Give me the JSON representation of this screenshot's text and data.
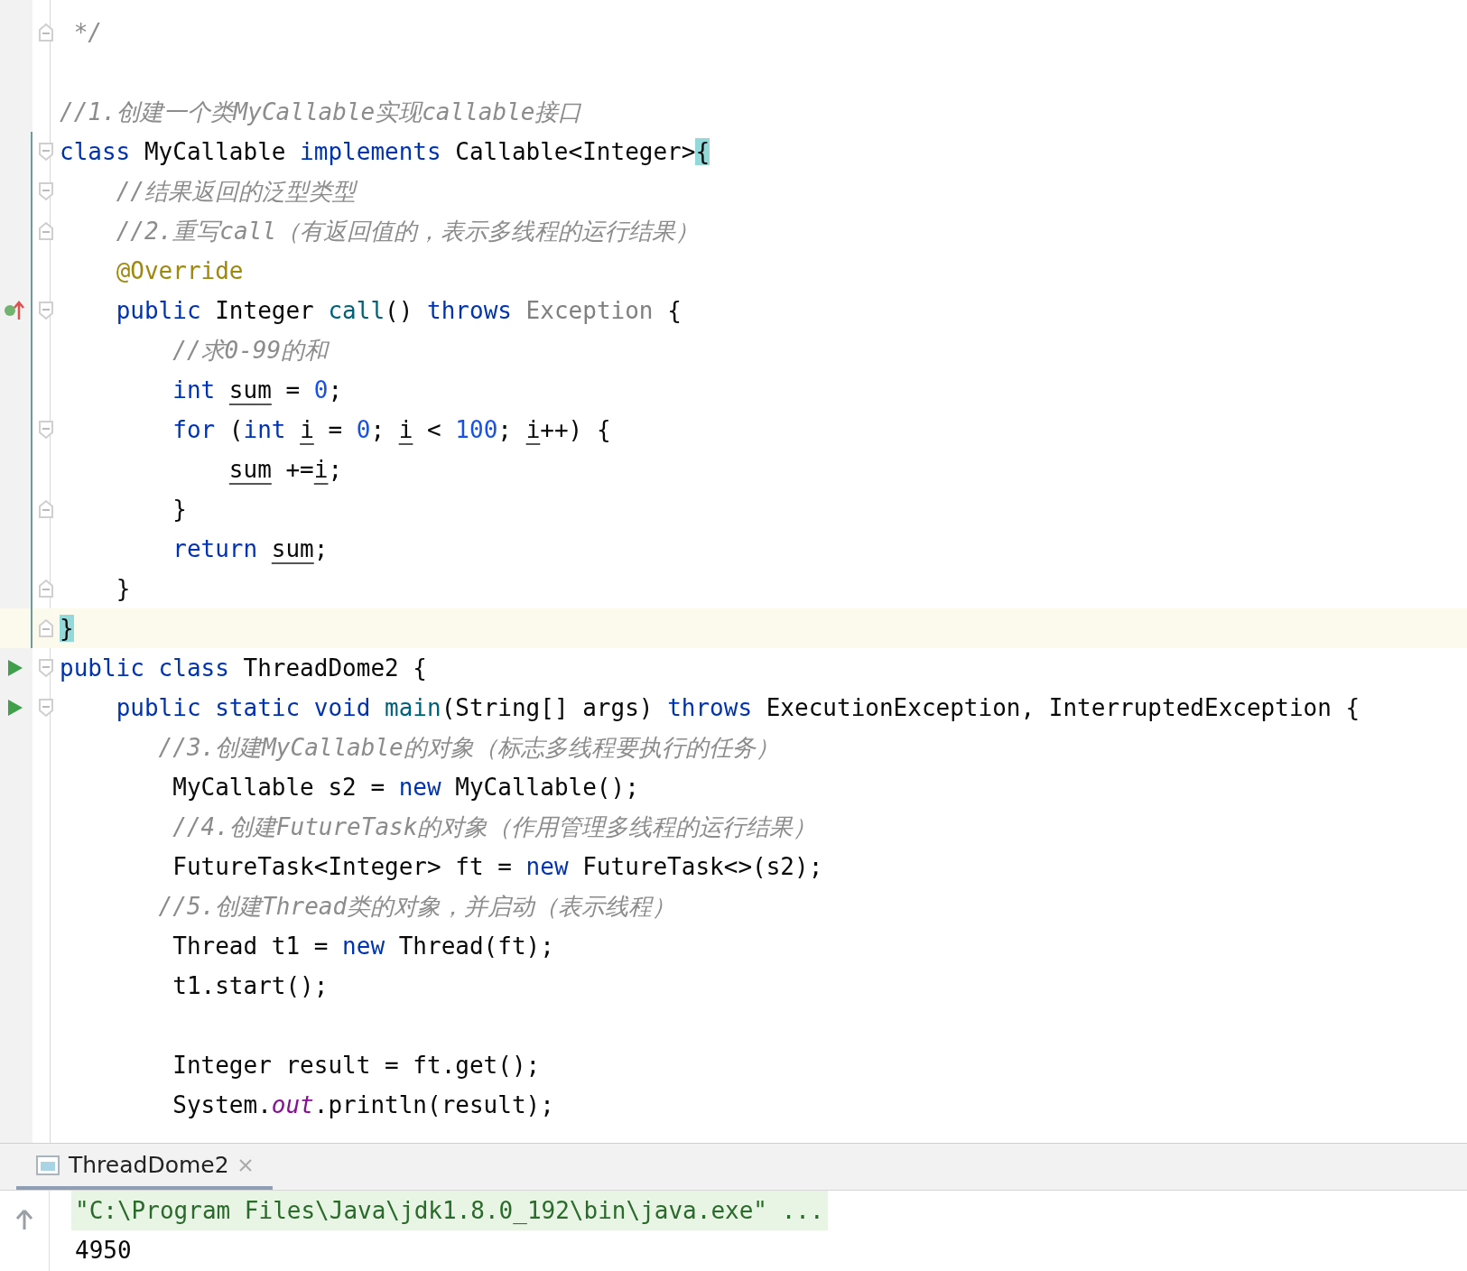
{
  "editor": {
    "lines": [
      {
        "fold_end": true,
        "tokens": [
          {
            "text": " */",
            "kind": "comment"
          }
        ]
      },
      {
        "kind": "blank"
      },
      {
        "tokens": [
          {
            "text": "//1.创建一个类MyCallable实现callable接口",
            "kind": "comment"
          }
        ]
      },
      {
        "changed": true,
        "fold_start": true,
        "tokens": [
          {
            "text": "class ",
            "kind": "keyword"
          },
          {
            "text": "MyCallable ",
            "kind": "plain"
          },
          {
            "text": "implements ",
            "kind": "keyword"
          },
          {
            "text": "Callable<Integer>",
            "kind": "plain"
          },
          {
            "text": "{",
            "kind": "matched"
          }
        ]
      },
      {
        "changed": true,
        "fold_start": true,
        "tokens": [
          {
            "text": "    //结果返回的泛型类型",
            "kind": "comment"
          }
        ]
      },
      {
        "changed": true,
        "fold_end": true,
        "tokens": [
          {
            "text": "    //2.重写call（有返回值的，表示多线程的运行结果）",
            "kind": "comment"
          }
        ]
      },
      {
        "changed": true,
        "tokens": [
          {
            "text": "    @Override",
            "kind": "annotation"
          }
        ]
      },
      {
        "changed": true,
        "fold_start": true,
        "override_marker": true,
        "tokens": [
          {
            "text": "    public ",
            "kind": "keyword"
          },
          {
            "text": "Integer ",
            "kind": "plain"
          },
          {
            "text": "call",
            "kind": "method"
          },
          {
            "text": "() ",
            "kind": "plain"
          },
          {
            "text": "throws ",
            "kind": "keyword"
          },
          {
            "text": "Exception ",
            "kind": "dim"
          },
          {
            "text": "{",
            "kind": "plain"
          }
        ]
      },
      {
        "changed": true,
        "tokens": [
          {
            "text": "        //求0-99的和",
            "kind": "comment"
          }
        ]
      },
      {
        "changed": true,
        "tokens": [
          {
            "text": "        int ",
            "kind": "keyword"
          },
          {
            "text": "sum",
            "kind": "variable"
          },
          {
            "text": " = ",
            "kind": "plain"
          },
          {
            "text": "0",
            "kind": "number"
          },
          {
            "text": ";",
            "kind": "plain"
          }
        ]
      },
      {
        "changed": true,
        "fold_start": true,
        "tokens": [
          {
            "text": "        for ",
            "kind": "keyword"
          },
          {
            "text": "(",
            "kind": "plain"
          },
          {
            "text": "int ",
            "kind": "keyword"
          },
          {
            "text": "i",
            "kind": "variable"
          },
          {
            "text": " = ",
            "kind": "plain"
          },
          {
            "text": "0",
            "kind": "number"
          },
          {
            "text": "; ",
            "kind": "plain"
          },
          {
            "text": "i",
            "kind": "variable"
          },
          {
            "text": " < ",
            "kind": "plain"
          },
          {
            "text": "100",
            "kind": "number"
          },
          {
            "text": "; ",
            "kind": "plain"
          },
          {
            "text": "i",
            "kind": "variable"
          },
          {
            "text": "++) {",
            "kind": "plain"
          }
        ]
      },
      {
        "changed": true,
        "tokens": [
          {
            "text": "            sum",
            "kind": "variable"
          },
          {
            "text": " +=",
            "kind": "plain"
          },
          {
            "text": "i",
            "kind": "variable"
          },
          {
            "text": ";",
            "kind": "plain"
          }
        ]
      },
      {
        "changed": true,
        "fold_end": true,
        "tokens": [
          {
            "text": "        }",
            "kind": "plain"
          }
        ]
      },
      {
        "changed": true,
        "tokens": [
          {
            "text": "        return ",
            "kind": "keyword"
          },
          {
            "text": "sum",
            "kind": "variable"
          },
          {
            "text": ";",
            "kind": "plain"
          }
        ]
      },
      {
        "changed": true,
        "fold_end": true,
        "tokens": [
          {
            "text": "    }",
            "kind": "plain"
          }
        ]
      },
      {
        "changed": true,
        "current": true,
        "fold_end": true,
        "tokens": [
          {
            "text": "}",
            "kind": "matched"
          }
        ]
      },
      {
        "fold_start": true,
        "run_marker": true,
        "tokens": [
          {
            "text": "public ",
            "kind": "keyword"
          },
          {
            "text": "class ",
            "kind": "keyword"
          },
          {
            "text": "ThreadDome2 {",
            "kind": "plain"
          }
        ]
      },
      {
        "fold_start": true,
        "run_marker": true,
        "tokens": [
          {
            "text": "    public ",
            "kind": "keyword"
          },
          {
            "text": "static ",
            "kind": "keyword"
          },
          {
            "text": "void ",
            "kind": "keyword"
          },
          {
            "text": "main",
            "kind": "method"
          },
          {
            "text": "(String[] args) ",
            "kind": "plain"
          },
          {
            "text": "throws ",
            "kind": "keyword"
          },
          {
            "text": "ExecutionException, InterruptedException {",
            "kind": "plain"
          }
        ]
      },
      {
        "tokens": [
          {
            "text": "       //3.创建MyCallable的对象（标志多线程要执行的任务）",
            "kind": "comment"
          }
        ]
      },
      {
        "tokens": [
          {
            "text": "        MyCallable s2 = ",
            "kind": "plain"
          },
          {
            "text": "new ",
            "kind": "keyword"
          },
          {
            "text": "MyCallable();",
            "kind": "plain"
          }
        ]
      },
      {
        "tokens": [
          {
            "text": "        //4.创建FutureTask的对象（作用管理多线程的运行结果）",
            "kind": "comment"
          }
        ]
      },
      {
        "tokens": [
          {
            "text": "        FutureTask<Integer> ft = ",
            "kind": "plain"
          },
          {
            "text": "new ",
            "kind": "keyword"
          },
          {
            "text": "FutureTask<>(s2);",
            "kind": "plain"
          }
        ]
      },
      {
        "tokens": [
          {
            "text": "       //5.创建Thread类的对象，并启动（表示线程）",
            "kind": "comment"
          }
        ]
      },
      {
        "tokens": [
          {
            "text": "        Thread t1 = ",
            "kind": "plain"
          },
          {
            "text": "new ",
            "kind": "keyword"
          },
          {
            "text": "Thread(ft);",
            "kind": "plain"
          }
        ]
      },
      {
        "tokens": [
          {
            "text": "        t1.start();",
            "kind": "plain"
          }
        ]
      },
      {
        "kind": "blank"
      },
      {
        "tokens": [
          {
            "text": "        Integer result = ft.get();",
            "kind": "plain"
          }
        ]
      },
      {
        "tokens": [
          {
            "text": "        System.",
            "kind": "plain"
          },
          {
            "text": "out",
            "kind": "field"
          },
          {
            "text": ".println(result);",
            "kind": "plain"
          }
        ]
      }
    ]
  },
  "run_panel": {
    "tabs": [
      {
        "label": "ThreadDome2",
        "selected": true
      }
    ],
    "console": [
      {
        "text": "\"C:\\Program Files\\Java\\jdk1.8.0_192\\bin\\java.exe\" ...",
        "kind": "command"
      },
      {
        "text": "4950",
        "kind": "output"
      }
    ]
  }
}
